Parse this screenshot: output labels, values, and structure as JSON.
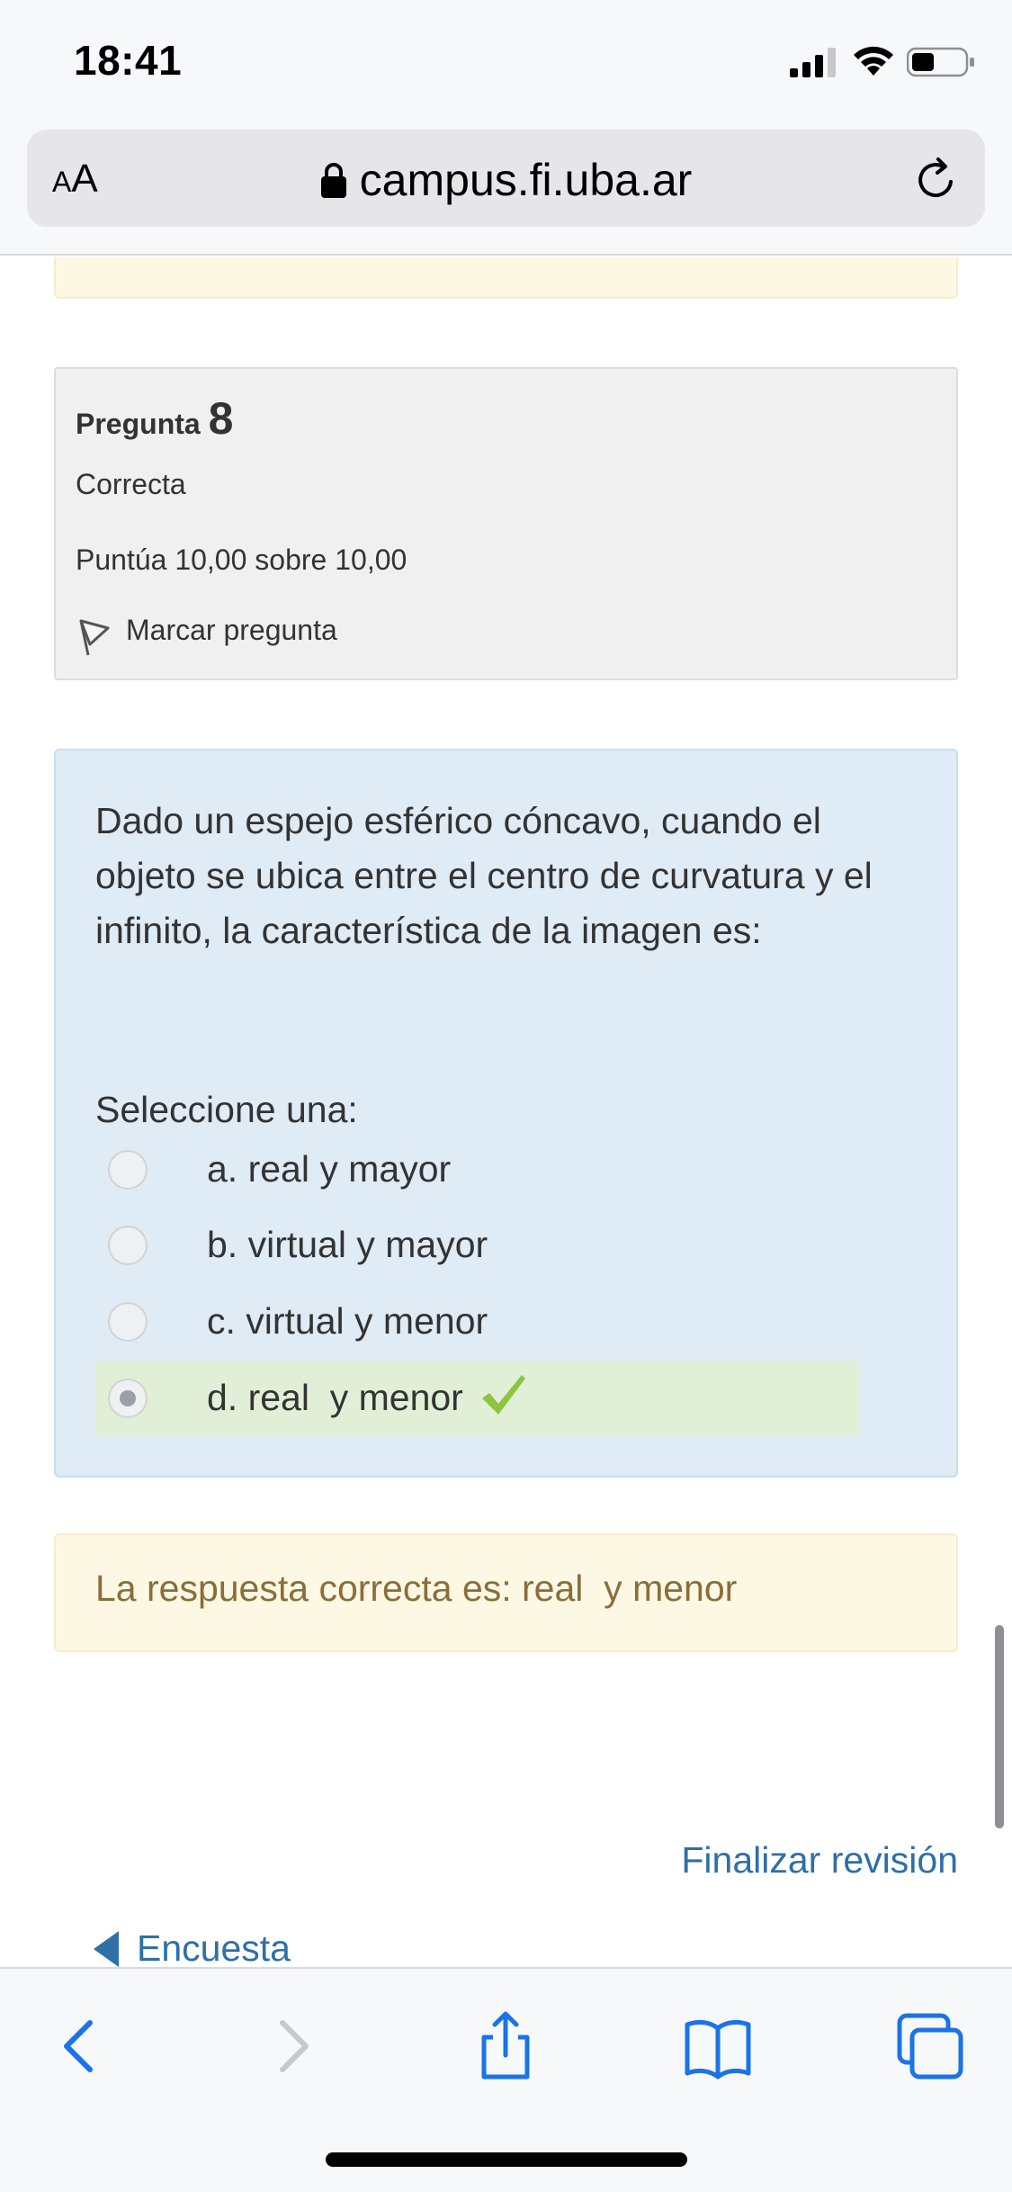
{
  "status_bar": {
    "time": "18:41"
  },
  "browser": {
    "text_size_label_small": "A",
    "text_size_label_large": "A",
    "url": "campus.fi.uba.ar"
  },
  "question_info": {
    "label": "Pregunta",
    "number": "8",
    "state": "Correcta",
    "grade": "Puntúa 10,00 sobre 10,00",
    "flag_label": "Marcar pregunta"
  },
  "question": {
    "text": "Dado un espejo esférico cóncavo, cuando el objeto se ubica entre el centro de curvatura y el infinito, la característica de la imagen es:",
    "prompt": "Seleccione una:",
    "options": [
      {
        "label": "a. real y mayor",
        "selected": false,
        "correct": false
      },
      {
        "label": "b. virtual y mayor",
        "selected": false,
        "correct": false
      },
      {
        "label": "c. virtual y menor",
        "selected": false,
        "correct": false
      },
      {
        "label": "d. real  y menor",
        "selected": true,
        "correct": true
      }
    ]
  },
  "feedback": {
    "right_answer": "La respuesta correcta es: real  y menor"
  },
  "navigation": {
    "finish_review": "Finalizar revisión",
    "previous_activity": "Encuesta"
  },
  "colors": {
    "link": "#2f6fa7",
    "correct_bg": "#e1efd7",
    "check": "#8cc63f",
    "formulation_bg": "#dfebf5",
    "feedback_bg": "#fcf8e3",
    "ios_blue": "#1a73e8"
  },
  "icons": [
    "signal-icon",
    "wifi-icon",
    "battery-icon",
    "lock-icon",
    "reload-icon",
    "flag-icon",
    "check-icon",
    "back-icon",
    "forward-icon",
    "share-icon",
    "bookmarks-icon",
    "tabs-icon"
  ]
}
